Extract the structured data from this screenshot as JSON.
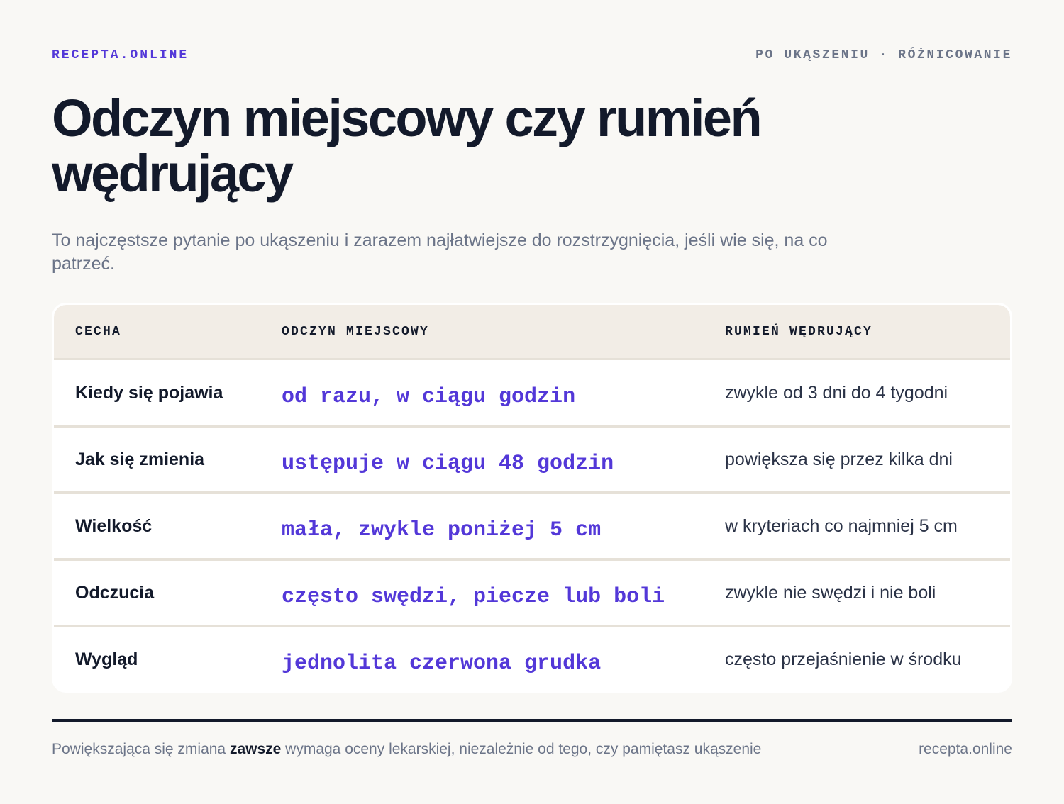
{
  "header": {
    "brand": "RECEPTA.ONLINE",
    "topic": "PO UKĄSZENIU · RÓŻNICOWANIE"
  },
  "title": "Odczyn miejscowy czy rumień wędrujący",
  "subtitle": "To najczęstsze pytanie po ukąszeniu i zarazem najłatwiejsze do rozstrzygnięcia, jeśli wie się, na co patrzeć.",
  "table": {
    "columns": [
      "CECHA",
      "ODCZYN MIEJSCOWY",
      "RUMIEŃ WĘDRUJĄCY"
    ],
    "rows": [
      {
        "feature": "Kiedy się pojawia",
        "local": "od razu, w ciągu godzin",
        "em": "zwykle od 3 dni do 4 tygodni"
      },
      {
        "feature": "Jak się zmienia",
        "local": "ustępuje w ciągu 48 godzin",
        "em": "powiększa się przez kilka dni"
      },
      {
        "feature": "Wielkość",
        "local": "mała, zwykle poniżej 5 cm",
        "em": "w kryteriach co najmniej 5 cm"
      },
      {
        "feature": "Odczucia",
        "local": "często swędzi, piecze lub boli",
        "em": "zwykle nie swędzi i nie boli"
      },
      {
        "feature": "Wygląd",
        "local": "jednolita czerwona grudka",
        "em": "często przejaśnienie w środku"
      }
    ]
  },
  "footer": {
    "note_before": "Powiększająca się zmiana ",
    "note_bold": "zawsze",
    "note_after": " wymaga oceny lekarskiej, niezależnie od tego, czy pamiętasz ukąszenie",
    "site": "recepta.online"
  },
  "colors": {
    "accent": "#5338d8",
    "text": "#131a2b",
    "muted": "#6b7488",
    "background": "#f9f8f5",
    "table_header": "#f2ede6"
  }
}
